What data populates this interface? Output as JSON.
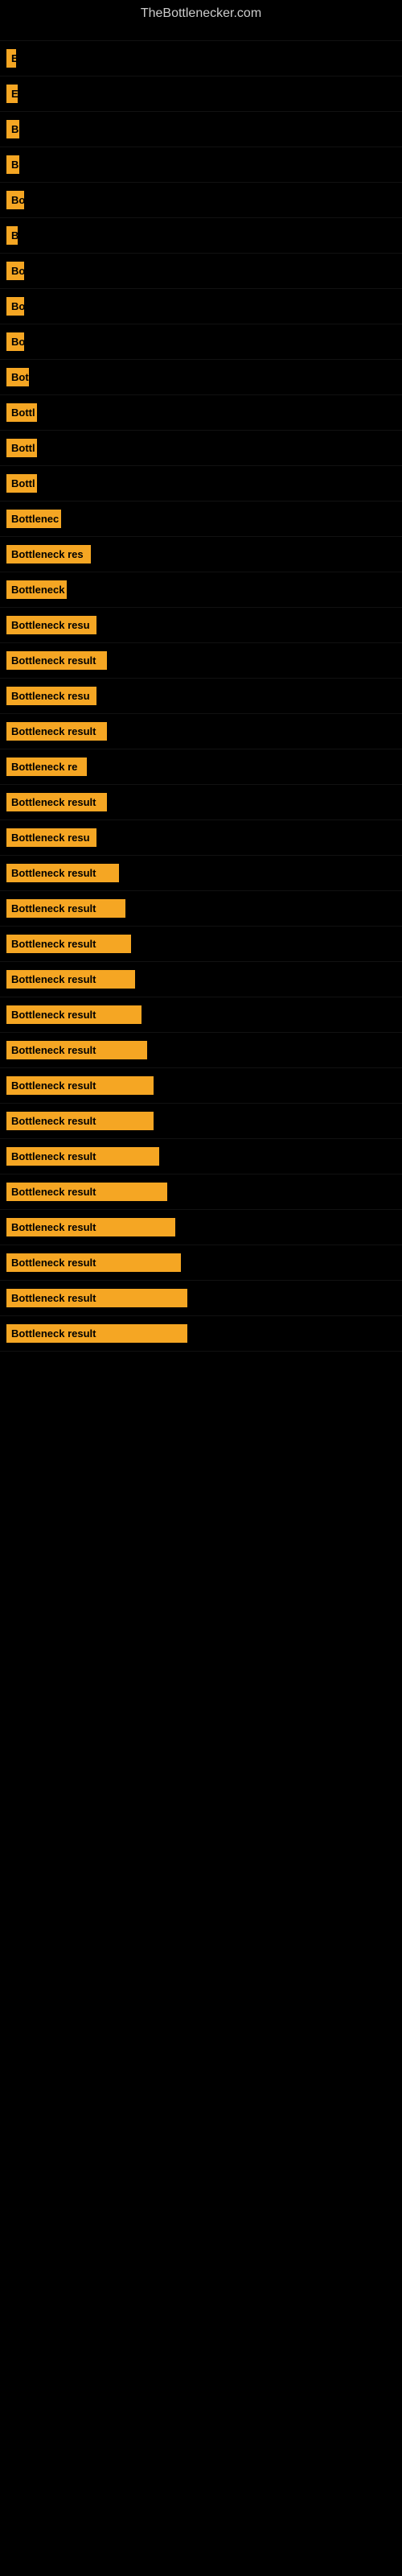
{
  "site": {
    "title": "TheBottlenecker.com"
  },
  "items": [
    {
      "label": "",
      "labelWidth": 8,
      "paddingTop": 30
    },
    {
      "label": "E",
      "labelWidth": 12,
      "paddingTop": 0
    },
    {
      "label": "E",
      "labelWidth": 14,
      "paddingTop": 0
    },
    {
      "label": "B",
      "labelWidth": 16,
      "paddingTop": 0
    },
    {
      "label": "B",
      "labelWidth": 16,
      "paddingTop": 0
    },
    {
      "label": "Bo",
      "labelWidth": 22,
      "paddingTop": 0
    },
    {
      "label": "B",
      "labelWidth": 14,
      "paddingTop": 0
    },
    {
      "label": "Bo",
      "labelWidth": 22,
      "paddingTop": 0
    },
    {
      "label": "Bo",
      "labelWidth": 22,
      "paddingTop": 0
    },
    {
      "label": "Bo",
      "labelWidth": 22,
      "paddingTop": 0
    },
    {
      "label": "Bot",
      "labelWidth": 28,
      "paddingTop": 0
    },
    {
      "label": "Bottl",
      "labelWidth": 38,
      "paddingTop": 0
    },
    {
      "label": "Bottl",
      "labelWidth": 38,
      "paddingTop": 0
    },
    {
      "label": "Bottl",
      "labelWidth": 38,
      "paddingTop": 0
    },
    {
      "label": "Bottlenec",
      "labelWidth": 68,
      "paddingTop": 0
    },
    {
      "label": "Bottleneck res",
      "labelWidth": 105,
      "paddingTop": 0
    },
    {
      "label": "Bottleneck",
      "labelWidth": 75,
      "paddingTop": 0
    },
    {
      "label": "Bottleneck resu",
      "labelWidth": 112,
      "paddingTop": 0
    },
    {
      "label": "Bottleneck result",
      "labelWidth": 125,
      "paddingTop": 0
    },
    {
      "label": "Bottleneck resu",
      "labelWidth": 112,
      "paddingTop": 0
    },
    {
      "label": "Bottleneck result",
      "labelWidth": 125,
      "paddingTop": 0
    },
    {
      "label": "Bottleneck re",
      "labelWidth": 100,
      "paddingTop": 0
    },
    {
      "label": "Bottleneck result",
      "labelWidth": 125,
      "paddingTop": 0
    },
    {
      "label": "Bottleneck resu",
      "labelWidth": 112,
      "paddingTop": 0
    },
    {
      "label": "Bottleneck result",
      "labelWidth": 140,
      "paddingTop": 0
    },
    {
      "label": "Bottleneck result",
      "labelWidth": 148,
      "paddingTop": 0
    },
    {
      "label": "Bottleneck result",
      "labelWidth": 155,
      "paddingTop": 0
    },
    {
      "label": "Bottleneck result",
      "labelWidth": 160,
      "paddingTop": 0
    },
    {
      "label": "Bottleneck result",
      "labelWidth": 168,
      "paddingTop": 0
    },
    {
      "label": "Bottleneck result",
      "labelWidth": 175,
      "paddingTop": 0
    },
    {
      "label": "Bottleneck result",
      "labelWidth": 183,
      "paddingTop": 0
    },
    {
      "label": "Bottleneck result",
      "labelWidth": 183,
      "paddingTop": 0
    },
    {
      "label": "Bottleneck result",
      "labelWidth": 190,
      "paddingTop": 0
    },
    {
      "label": "Bottleneck result",
      "labelWidth": 200,
      "paddingTop": 0
    },
    {
      "label": "Bottleneck result",
      "labelWidth": 210,
      "paddingTop": 0
    },
    {
      "label": "Bottleneck result",
      "labelWidth": 217,
      "paddingTop": 0
    },
    {
      "label": "Bottleneck result",
      "labelWidth": 225,
      "paddingTop": 0
    },
    {
      "label": "Bottleneck result",
      "labelWidth": 225,
      "paddingTop": 0
    }
  ]
}
